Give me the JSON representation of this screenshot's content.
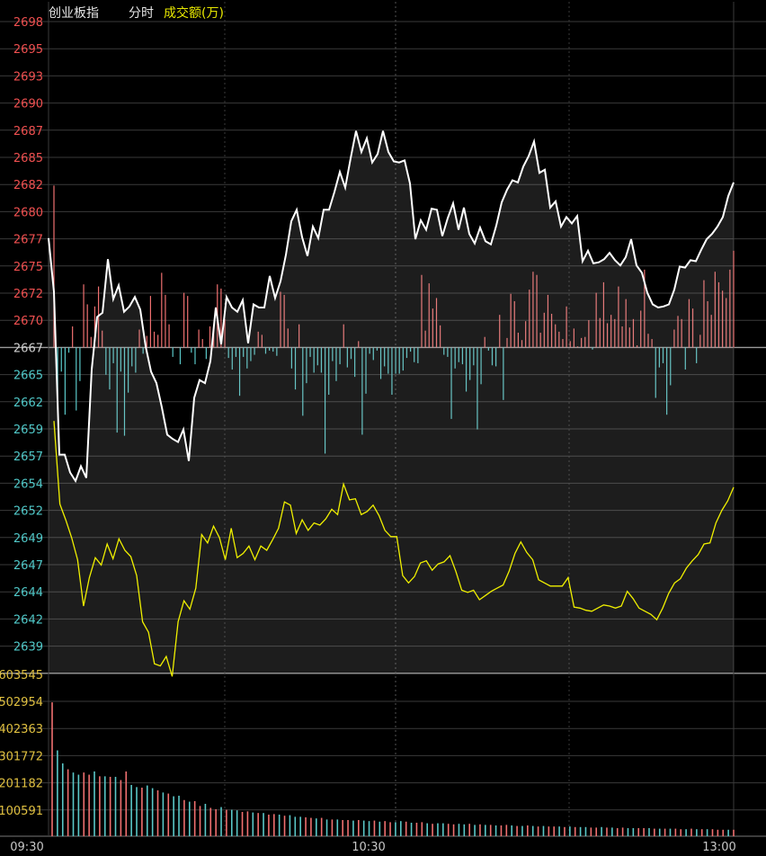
{
  "header": {
    "index_name": "创业板指",
    "mode_label": "分时",
    "metric_label": "成交额(万)"
  },
  "colors": {
    "background": "#000000",
    "grid": "#3a3a3a",
    "price_line": "#ffffff",
    "amount_line": "#f0f000",
    "up": "#f07070",
    "down": "#5ac8c8",
    "up_label": "#f05050",
    "down_label": "#50c8c8",
    "volume_label": "#e0c040",
    "time_label": "#c8c8c8"
  },
  "chart_data": [
    {
      "type": "line",
      "title": "创业板指 分时",
      "ylabels": [
        "2698",
        "2695",
        "2693",
        "2690",
        "2687",
        "2685",
        "2682",
        "2680",
        "2677",
        "2675",
        "2672",
        "2670",
        "2667",
        "2665",
        "2662",
        "2659",
        "2657",
        "2654",
        "2652",
        "2649",
        "2647",
        "2644",
        "2642",
        "2639"
      ],
      "ylim": [
        2638.5,
        2698.5
      ],
      "baseline": 2667,
      "x_labels": [
        "09:30",
        "10:30",
        "13:00"
      ],
      "series": [
        {
          "key": "price",
          "values": [
            2677.4,
            2672.3,
            2656.8,
            2656.8,
            2655.1,
            2654.3,
            2655.7,
            2654.6,
            2664.9,
            2669.9,
            2670.3,
            2675.4,
            2671.6,
            2672.9,
            2670.4,
            2670.9,
            2671.8,
            2670.6,
            2667.1,
            2664.7,
            2663.6,
            2661.3,
            2658.7,
            2658.3,
            2658.0,
            2659.2,
            2656.2,
            2662.2,
            2663.9,
            2663.6,
            2665.7,
            2670.8,
            2667.3,
            2671.8,
            2670.8,
            2670.4,
            2671.5,
            2667.4,
            2671.1,
            2670.8,
            2670.8,
            2673.8,
            2671.7,
            2673.3,
            2675.8,
            2679.0,
            2680.1,
            2677.5,
            2675.7,
            2678.5,
            2677.4,
            2680.1,
            2680.1,
            2681.8,
            2683.7,
            2682.2,
            2685.0,
            2687.6,
            2685.6,
            2686.9,
            2684.6,
            2685.4,
            2687.6,
            2685.6,
            2684.7,
            2684.6,
            2684.8,
            2682.6,
            2677.3,
            2679.1,
            2678.2,
            2680.2,
            2680.1,
            2677.6,
            2679.3,
            2680.7,
            2678.2,
            2680.3,
            2677.8,
            2676.9,
            2678.4,
            2677.1,
            2676.8,
            2678.6,
            2680.8,
            2682.0,
            2682.9,
            2682.7,
            2684.2,
            2685.2,
            2686.6,
            2683.6,
            2683.9,
            2680.3,
            2680.9,
            2678.5,
            2679.4,
            2678.8,
            2679.5,
            2675.2,
            2676.2,
            2675.0,
            2675.1,
            2675.4,
            2676.0,
            2675.3,
            2674.8,
            2675.6,
            2677.3,
            2674.8,
            2674.1,
            2672.2,
            2671.1,
            2670.8,
            2670.9,
            2671.1,
            2672.5,
            2674.7,
            2674.6,
            2675.3,
            2675.2,
            2676.3,
            2677.3,
            2677.8,
            2678.5,
            2679.4,
            2681.4,
            2682.7
          ]
        },
        {
          "key": "amount_trend",
          "values": [
            2660.0,
            2652.1,
            2650.6,
            2648.9,
            2646.8,
            2642.4,
            2645.1,
            2647.0,
            2646.3,
            2648.3,
            2646.9,
            2648.8,
            2647.7,
            2647.1,
            2645.3,
            2640.9,
            2639.9,
            2636.9,
            2636.7,
            2637.6,
            2635.7,
            2640.9,
            2642.9,
            2642.1,
            2644.1,
            2649.2,
            2648.4,
            2650.0,
            2648.9,
            2646.8,
            2649.8,
            2647.0,
            2647.4,
            2648.1,
            2646.8,
            2648.1,
            2647.7,
            2648.7,
            2649.8,
            2652.3,
            2652.0,
            2649.3,
            2650.6,
            2649.6,
            2650.3,
            2650.1,
            2650.7,
            2651.6,
            2651.1,
            2654.0,
            2652.5,
            2652.6,
            2651.1,
            2651.4,
            2652.0,
            2651.0,
            2649.6,
            2649.0,
            2649.0,
            2645.3,
            2644.6,
            2645.2,
            2646.5,
            2646.7,
            2645.8,
            2646.4,
            2646.6,
            2647.2,
            2645.7,
            2643.9,
            2643.7,
            2643.9,
            2643.0,
            2643.4,
            2643.8,
            2644.1,
            2644.4,
            2645.7,
            2647.4,
            2648.5,
            2647.5,
            2646.8,
            2644.9,
            2644.6,
            2644.3,
            2644.3,
            2644.3,
            2645.1,
            2642.3,
            2642.2,
            2642.0,
            2641.9,
            2642.2,
            2642.5,
            2642.4,
            2642.2,
            2642.4,
            2643.8,
            2643.1,
            2642.2,
            2641.9,
            2641.6,
            2641.1,
            2642.2,
            2643.6,
            2644.6,
            2645.0,
            2646.0,
            2646.7,
            2647.3,
            2648.3,
            2648.4,
            2650.3,
            2651.5,
            2652.4,
            2653.7
          ]
        }
      ],
      "deviation_bars": [
        15.4,
        -6.2,
        -2.3,
        -6.4,
        -0.5,
        2.0,
        -6.0,
        -3.2,
        6.0,
        4.1,
        1.0,
        3.9,
        5.8,
        1.6,
        -2.6,
        -4.0,
        -1.5,
        -8.1,
        -2.3,
        -8.4,
        -4.3,
        -1.8,
        -2.4,
        1.7,
        -0.6,
        1.1,
        4.9,
        1.5,
        1.2,
        7.1,
        5.0,
        2.2,
        -0.9,
        0.0,
        -1.6,
        5.2,
        4.9,
        -0.5,
        -1.6,
        1.7,
        0.8,
        -1.1,
        2.0,
        1.8,
        6.0,
        5.6,
        2.7,
        -1.0,
        -2.1,
        -0.9,
        -4.6,
        -0.9,
        -2.0,
        -1.3,
        -0.7,
        1.5,
        1.2,
        -0.6,
        -0.3,
        -0.4,
        -0.8,
        5.3,
        5.0,
        1.8,
        -2.0,
        -4.0,
        2.2,
        -6.5,
        -3.4,
        -0.9,
        -2.4,
        -1.7,
        -2.4,
        -10.1,
        -4.5,
        -1.3,
        -3.2,
        -1.6,
        2.2,
        -1.9,
        -1.1,
        -2.8,
        0.6,
        -8.3,
        -4.4,
        -0.6,
        -1.2,
        -0.3,
        -3.0,
        -1.8,
        -2.5,
        -4.5,
        -2.5,
        -2.5,
        -2.2,
        -1.0,
        -0.4,
        -1.4,
        -1.5,
        6.9,
        1.6,
        6.1,
        3.7,
        4.7,
        2.1,
        -0.7,
        -0.9,
        -6.8,
        -2.0,
        -1.4,
        -1.6,
        -4.2,
        -3.1,
        -1.7,
        -7.8,
        -3.5,
        1.0,
        -0.3,
        -1.7,
        -1.8,
        3.1,
        -5.0,
        0.9,
        5.1,
        4.4,
        1.4,
        0.7,
        2.5,
        5.5,
        7.2,
        6.9,
        1.4,
        3.3,
        5.0,
        3.2,
        2.2,
        1.5,
        0.8,
        3.9,
        0.6,
        1.8,
        0.1,
        0.9,
        1.0,
        2.6,
        -0.2,
        5.2,
        2.8,
        6.2,
        2.3,
        3.1,
        2.7,
        5.8,
        2.0,
        4.6,
        1.9,
        2.7,
        0.2,
        3.5,
        7.4,
        1.3,
        0.8,
        -4.8,
        -1.9,
        -1.5,
        -6.4,
        -3.6,
        1.7,
        3.0,
        2.7,
        -2.1,
        4.6,
        3.7,
        -1.5,
        1.2,
        6.4,
        4.4,
        3.1,
        7.2,
        6.2,
        5.4,
        4.7,
        7.4,
        9.2
      ]
    },
    {
      "type": "bar",
      "title": "成交额(万)",
      "ylabels": [
        "603545",
        "502954",
        "402363",
        "301772",
        "201182",
        "100591"
      ],
      "ylim": [
        0,
        603545
      ],
      "volumes": [
        496000,
        318000,
        270000,
        248000,
        236000,
        228000,
        236000,
        228000,
        240000,
        222000,
        222000,
        220000,
        220000,
        208000,
        240000,
        190000,
        182000,
        180000,
        188000,
        178000,
        170000,
        162000,
        158000,
        148000,
        150000,
        134000,
        128000,
        130000,
        112000,
        120000,
        105000,
        100000,
        108000,
        98000,
        98000,
        96000,
        90000,
        92000,
        88000,
        86000,
        86000,
        80000,
        82000,
        80000,
        76000,
        78000,
        72000,
        72000,
        70000,
        68000,
        66000,
        68000,
        62000,
        62000,
        62000,
        60000,
        60000,
        58000,
        60000,
        58000,
        56000,
        58000,
        54000,
        56000,
        52000,
        52000,
        56000,
        54000,
        50000,
        50000,
        52000,
        48000,
        46000,
        48000,
        48000,
        46000,
        44000,
        46000,
        44000,
        46000,
        42000,
        44000,
        42000,
        42000,
        40000,
        40000,
        42000,
        40000,
        38000,
        38000,
        40000,
        38000,
        36000,
        38000,
        36000,
        36000,
        36000,
        34000,
        36000,
        34000,
        34000,
        34000,
        32000,
        32000,
        34000,
        32000,
        32000,
        30000,
        32000,
        30000,
        30000,
        30000,
        30000,
        30000,
        28000,
        28000,
        28000,
        28000,
        28000,
        26000,
        26000,
        28000,
        26000,
        26000,
        26000,
        26000,
        24000,
        24000,
        24000,
        24000
      ],
      "volume_up": [
        true,
        false,
        false,
        true,
        false,
        false,
        true,
        true,
        false,
        true,
        false,
        true,
        false,
        true,
        true,
        false,
        false,
        true,
        false,
        false,
        true,
        false,
        true,
        false,
        false,
        true,
        false,
        true,
        true,
        false,
        true,
        true,
        false,
        true,
        false,
        false,
        true,
        true,
        false,
        true,
        false,
        true,
        true,
        false,
        true,
        false,
        false,
        false,
        true,
        true,
        false,
        true,
        false,
        true,
        false,
        true,
        true,
        false,
        true,
        false,
        false,
        true,
        false,
        true,
        true,
        false,
        false,
        true,
        false,
        true,
        true,
        false,
        true,
        false,
        false,
        true,
        true,
        false,
        false,
        true,
        false,
        true,
        false,
        true,
        false,
        true,
        true,
        false,
        true,
        false,
        true,
        false,
        true,
        false,
        true,
        true,
        false,
        true,
        false,
        true,
        false,
        false,
        true,
        true,
        false,
        true,
        false,
        true,
        true,
        false,
        false,
        true,
        true,
        false,
        true,
        false,
        true,
        false,
        true,
        true,
        false,
        true,
        false,
        true,
        false,
        true,
        true,
        true,
        false,
        true
      ]
    }
  ]
}
